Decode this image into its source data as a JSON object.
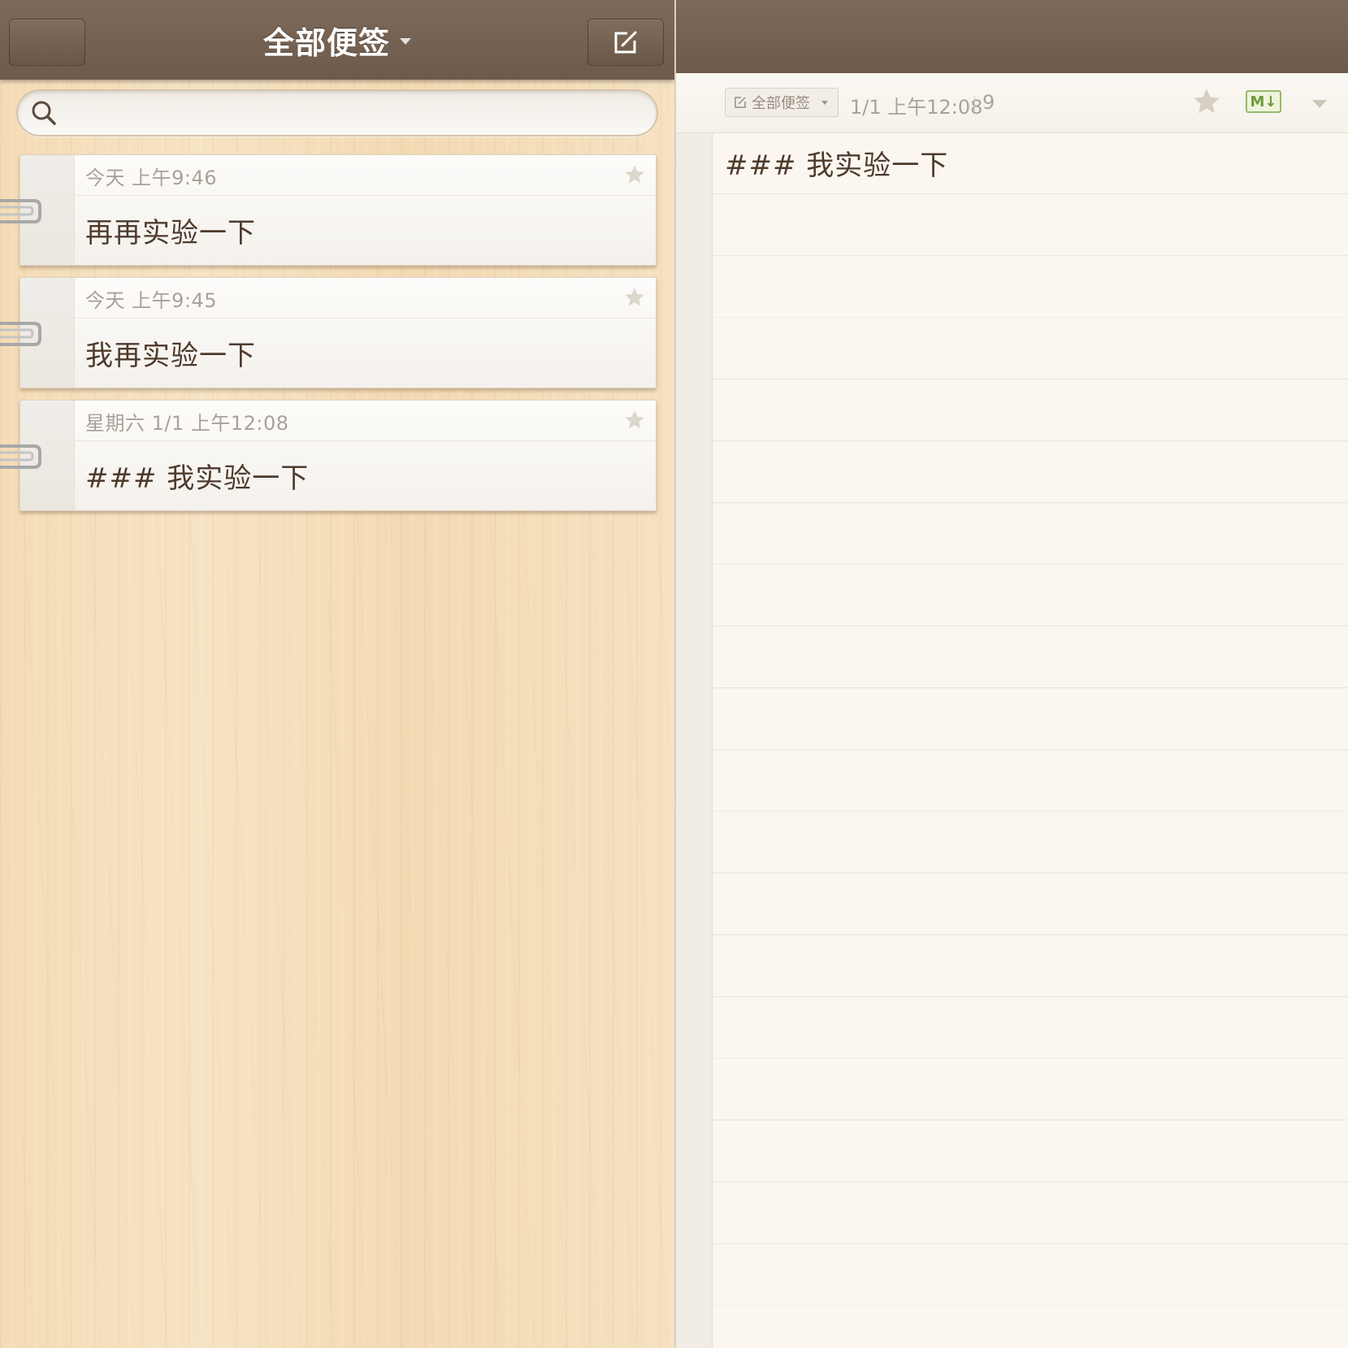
{
  "header": {
    "title": "全部便签"
  },
  "search": {
    "value": "",
    "placeholder": ""
  },
  "notes": [
    {
      "date": "今天 上午9:46",
      "title": "再再实验一下"
    },
    {
      "date": "今天 上午9:45",
      "title": "我再实验一下"
    },
    {
      "date": "星期六 1/1 上午12:08",
      "title": "### 我实验一下"
    }
  ],
  "editor": {
    "folder_label": "全部便签",
    "date": "1/1 上午12:08",
    "char_count": "9",
    "markdown_badge": "M↓",
    "content_line": "### 我实验一下"
  },
  "icons": {
    "search": "search-icon",
    "compose": "compose-icon",
    "star": "star-icon",
    "paperclip": "paperclip-icon",
    "edit": "edit-icon"
  },
  "colors": {
    "header_bg": "#76624f",
    "note_text": "#4e3a2c",
    "meta_text": "#aaa198",
    "markdown_green": "#6d9a3a"
  }
}
